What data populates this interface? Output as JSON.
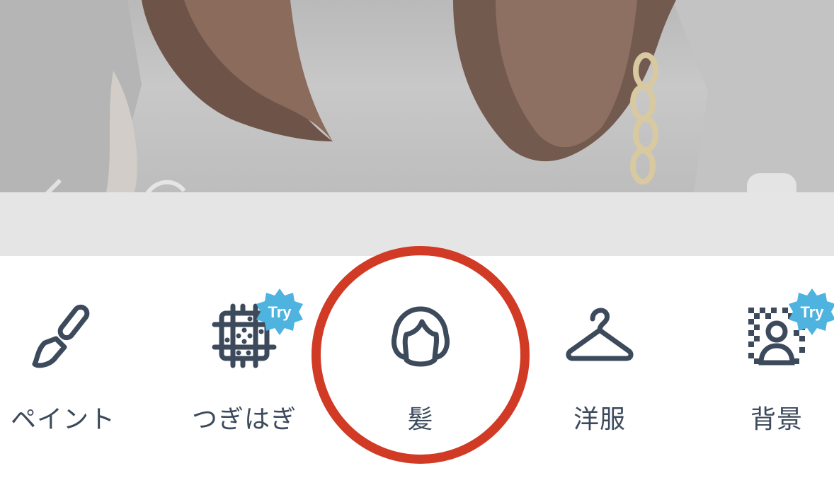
{
  "photo": {
    "description_icon": "photo-preview"
  },
  "toolbar": {
    "items": [
      {
        "id": "paint",
        "label": "ペイント",
        "icon": "paintbrush-icon",
        "badge": null
      },
      {
        "id": "patch",
        "label": "つぎはぎ",
        "icon": "patch-icon",
        "badge": "Try"
      },
      {
        "id": "hair",
        "label": "髪",
        "icon": "hair-icon",
        "badge": null
      },
      {
        "id": "clothes",
        "label": "洋服",
        "icon": "hanger-icon",
        "badge": null
      },
      {
        "id": "background",
        "label": "背景",
        "icon": "background-person-icon",
        "badge": "Try"
      }
    ]
  },
  "colors": {
    "icon": "#3c4a5c",
    "badge": "#4fb3e0",
    "highlight": "#d13a24",
    "band": "#e5e5e5"
  }
}
